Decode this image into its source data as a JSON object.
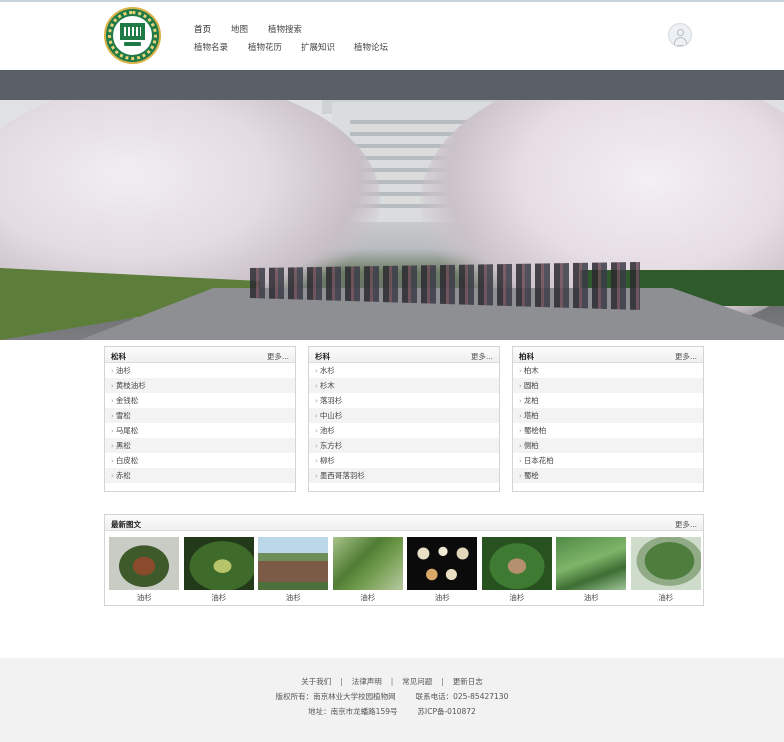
{
  "nav": {
    "row1": [
      "首页",
      "地图",
      "植物搜索"
    ],
    "row2": [
      "植物名录",
      "植物花历",
      "扩展知识",
      "植物论坛"
    ]
  },
  "banner": {
    "slides": 4,
    "active_slide": 3
  },
  "panels": [
    {
      "title": "松科",
      "more": "更多...",
      "items": [
        "油杉",
        "黄枝油杉",
        "金钱松",
        "雪松",
        "马尾松",
        "黑松",
        "白皮松",
        "赤松"
      ]
    },
    {
      "title": "杉科",
      "more": "更多...",
      "items": [
        "水杉",
        "杉木",
        "落羽杉",
        "中山杉",
        "池杉",
        "东方杉",
        "柳杉",
        "墨西哥落羽杉"
      ]
    },
    {
      "title": "柏科",
      "more": "更多...",
      "items": [
        "柏木",
        "圆柏",
        "龙柏",
        "塔柏",
        "蜀桧柏",
        "侧柏",
        "日本花柏",
        "蜀桧"
      ]
    }
  ],
  "gallery": {
    "title": "最新图文",
    "more": "更多...",
    "items": [
      "油杉",
      "油杉",
      "油杉",
      "油杉",
      "油杉",
      "油杉",
      "油杉",
      "油杉"
    ]
  },
  "footer": {
    "links": [
      "关于我们",
      "法律声明",
      "常见问题",
      "更新日志"
    ],
    "link_sep": "|",
    "copyright": "版权所有：南京林业大学校园植物网",
    "phone": "联系电话：025-85427130",
    "address": "地址：南京市龙蟠路159号",
    "icp": "苏ICP备-010872"
  }
}
